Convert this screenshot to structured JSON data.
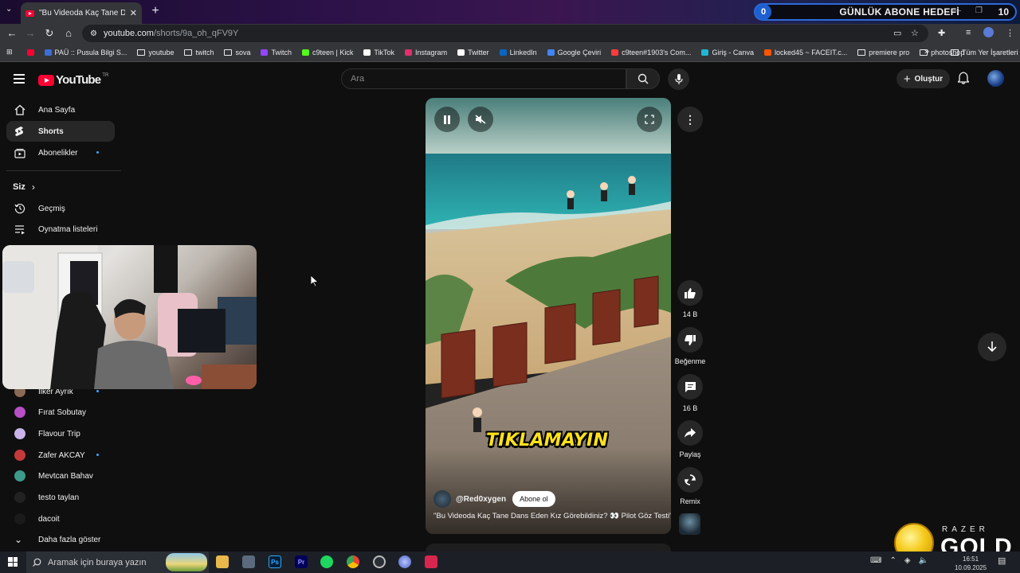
{
  "browser": {
    "tab_title": "\"Bu Videoda Kaç Tane Dans Ede",
    "url_host": "youtube.com",
    "url_path": "/shorts/9a_oh_qFV9Y",
    "bookmarks": [
      {
        "label": "PAÜ :: Pusula Bilgi S...",
        "color": "#3b6fd6",
        "type": "site"
      },
      {
        "label": "youtube",
        "color": "",
        "type": "folder"
      },
      {
        "label": "twitch",
        "color": "",
        "type": "folder"
      },
      {
        "label": "sova",
        "color": "",
        "type": "folder"
      },
      {
        "label": "Twitch",
        "color": "#9146ff",
        "type": "site"
      },
      {
        "label": "c9teen | Kick",
        "color": "#53fc18",
        "type": "site"
      },
      {
        "label": "TikTok",
        "color": "#ffffff",
        "type": "site"
      },
      {
        "label": "Instagram",
        "color": "#e1306c",
        "type": "site"
      },
      {
        "label": "Twitter",
        "color": "#ffffff",
        "type": "site"
      },
      {
        "label": "LinkedIn",
        "color": "#0a66c2",
        "type": "site"
      },
      {
        "label": "Google Çeviri",
        "color": "#4285f4",
        "type": "site"
      },
      {
        "label": "c9teen#1903's Com...",
        "color": "#ff3b3b",
        "type": "site"
      },
      {
        "label": "Giriş - Canva",
        "color": "#1fb6d4",
        "type": "site"
      },
      {
        "label": "locked45 ~ FACEIT.c...",
        "color": "#ff5500",
        "type": "site"
      },
      {
        "label": "premiere pro",
        "color": "",
        "type": "folder"
      },
      {
        "label": "photoshop",
        "color": "",
        "type": "folder"
      }
    ],
    "all_bookmarks": "Tüm Yer İşaretleri"
  },
  "overlay": {
    "goal_current": "0",
    "goal_label": "GÜNLÜK ABONE HEDEFİ",
    "goal_target": "10",
    "razer_top": "RAZER",
    "razer_gold": "GOLD"
  },
  "youtube": {
    "logo_text": "YouTube",
    "region": "TR",
    "search_placeholder": "Ara",
    "create_label": "Oluştur",
    "sidebar": {
      "main": [
        {
          "label": "Ana Sayfa",
          "icon": "home-icon"
        },
        {
          "label": "Shorts",
          "icon": "shorts-icon"
        },
        {
          "label": "Abonelikler",
          "icon": "subscriptions-icon"
        }
      ],
      "you_label": "Siz",
      "you_items": [
        {
          "label": "Geçmiş",
          "icon": "history-icon"
        },
        {
          "label": "Oynatma listeleri",
          "icon": "playlists-icon"
        }
      ],
      "subscriptions": [
        {
          "label": "İlker Ayrık",
          "color": "#8a6a55"
        },
        {
          "label": "Fırat Sobutay",
          "color": "#b84fc4"
        },
        {
          "label": "Flavour Trip",
          "color": "#c9b3e8"
        },
        {
          "label": "Zafer AKCAY",
          "color": "#c43a3a"
        },
        {
          "label": "Mevtcan Bahav",
          "color": "#3e9a8a"
        },
        {
          "label": "testo taylan",
          "color": "#222222"
        },
        {
          "label": "dacoit",
          "color": "#1a1a1a"
        }
      ],
      "show_more": "Daha fazla göster"
    },
    "short": {
      "caption": "TIKLAMAYIN",
      "channel": "@Red0xygen",
      "subscribe": "Abone ol",
      "title": "\"Bu Videoda Kaç Tane Dans Eden Kız Görebildiniz? 👀 Pilot Göz Testi\""
    },
    "actions": {
      "likes": "14 B",
      "dislike": "Beğenme",
      "comments": "16 B",
      "share": "Paylaş",
      "remix": "Remix"
    }
  },
  "taskbar": {
    "search_placeholder": "Aramak için buraya yazın",
    "time": "16:51",
    "date": "10.09.2025"
  }
}
